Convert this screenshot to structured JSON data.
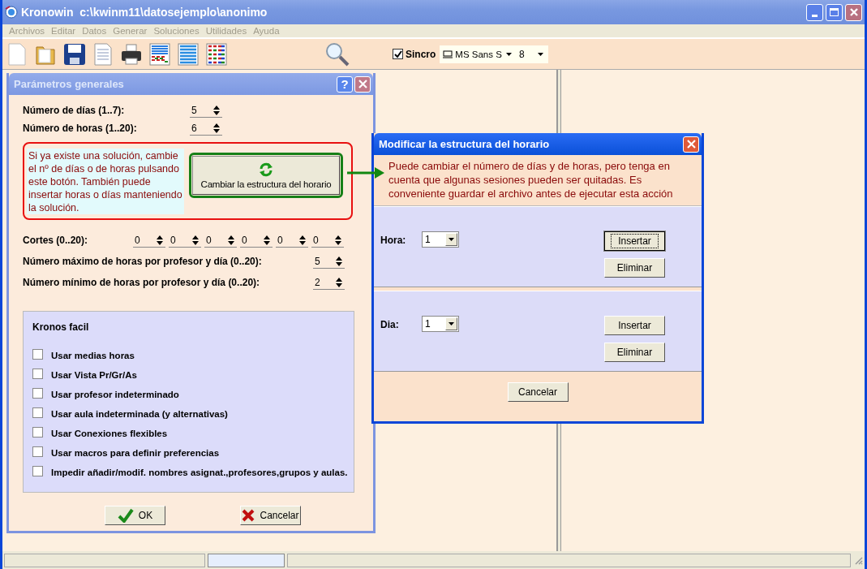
{
  "window": {
    "title": "Kronowin  c:\\kwinm11\\datosejemplo\\anonimo"
  },
  "menu": [
    "Archivos",
    "Editar",
    "Datos",
    "Generar",
    "Soluciones",
    "Utilidades",
    "Ayuda"
  ],
  "toolbar": {
    "sync": {
      "label": "Sincro",
      "checked": true
    },
    "font": "MS Sans S",
    "size": "8"
  },
  "params_dialog": {
    "title": "Parámetros generales",
    "help": "?",
    "top_fields": [
      {
        "label": "Número de días (1..7):",
        "value": "5"
      },
      {
        "label": "Número de horas (1..20):",
        "value": "6"
      }
    ],
    "note": "Si ya existe una solución, cambie el nº de días o de horas pulsando este botón. También puede insertar horas o días manteniendo la solución.",
    "change_button": "Cambiar la estructura del horario",
    "cortes": {
      "label": "Cortes (0..20):",
      "values": [
        "0",
        "0",
        "0",
        "0",
        "0",
        "0"
      ]
    },
    "limit_fields": [
      {
        "label": "Número máximo de horas por profesor y día (0..20):",
        "value": "5"
      },
      {
        "label": "Número mínimo de horas por profesor y día (0..20):",
        "value": "2"
      }
    ],
    "panel": {
      "title": "Kronos facil",
      "options": [
        {
          "label": "Usar medias horas",
          "checked": false
        },
        {
          "label": "Usar Vista Pr/Gr/As",
          "checked": false
        },
        {
          "label": "Usar profesor indeterminado",
          "checked": false
        },
        {
          "label": "Usar aula indeterminada (y alternativas)",
          "checked": false
        },
        {
          "label": "Usar Conexiones flexibles",
          "checked": false
        },
        {
          "label": "Usar macros para definir preferencias",
          "checked": false
        },
        {
          "label": "Impedir añadir/modif. nombres asignat.,profesores,grupos y aulas.",
          "checked": false
        }
      ]
    },
    "ok": "OK",
    "cancel": "Cancelar"
  },
  "structure_dialog": {
    "title": "Modificar la estructura del horario",
    "message": "Puede cambiar  el número de días y de horas, pero tenga en cuenta que algunas sesiones pueden ser  quitadas. Es conveniente guardar el archivo antes de ejecutar esta acción",
    "sections": [
      {
        "label": "Hora:",
        "value": "1",
        "buttons": [
          {
            "label": "Insertar",
            "focused": true
          },
          {
            "label": "Eliminar",
            "focused": false
          }
        ]
      },
      {
        "label": "Dia:",
        "value": "1",
        "buttons": [
          {
            "label": "Insertar",
            "focused": false
          },
          {
            "label": "Eliminar",
            "focused": false
          }
        ]
      }
    ],
    "cancel": "Cancelar"
  }
}
